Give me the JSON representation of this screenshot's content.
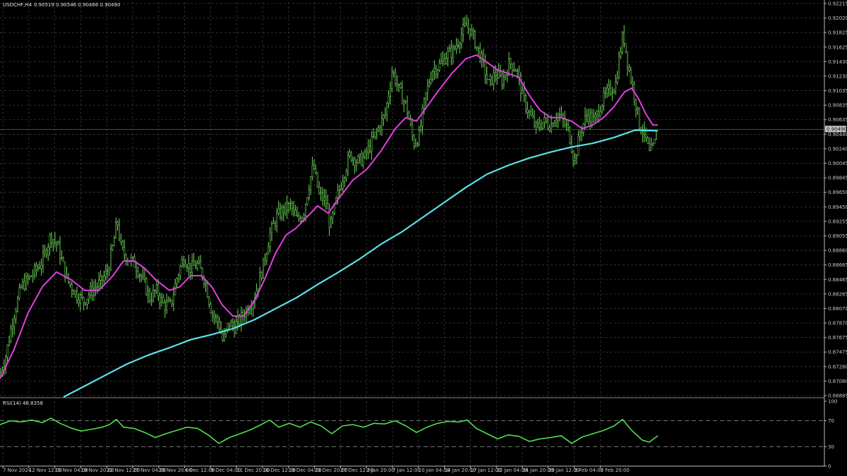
{
  "header": {
    "symbol": "USDCHF,H4",
    "ohlc": "0.90519 0.90546 0.90466 0.90490"
  },
  "rsi_header": "RSI(14) 46.8358",
  "colors": {
    "background": "#000000",
    "grid": "#3a3a3a",
    "axis": "#bdbdbd",
    "candle": "#6fd65a",
    "ma_fast": "#e040e0",
    "ma_slow": "#5fe0e8",
    "rsi": "#4ee04e",
    "price_tag_bg": "#c8c8c8"
  },
  "current_price_label": "0.90490",
  "chart_data": [
    {
      "type": "line",
      "title": "USDCHF,H4",
      "ylim": [
        0.8685,
        0.9222
      ],
      "y_ticks": [
        "0.92215",
        "0.92020",
        "0.91825",
        "0.91625",
        "0.91430",
        "0.91230",
        "0.91035",
        "0.90835",
        "0.90635",
        "0.90440",
        "0.90240",
        "0.90045",
        "0.89845",
        "0.89650",
        "0.89450",
        "0.89255",
        "0.89055",
        "0.88860",
        "0.88665",
        "0.88465",
        "0.88265",
        "0.88070",
        "0.87870",
        "0.87675",
        "0.87475",
        "0.87280",
        "0.87080",
        "0.86885"
      ],
      "x_ticks": [
        "7 Nov 2024",
        "12 Nov 12:00",
        "15 Nov 04:00",
        "19 Nov 20:00",
        "22 Nov 12:00",
        "27 Nov 04:00",
        "29 Nov 20:00",
        "4 Dec 12:00",
        "9 Dec 04:00",
        "11 Dec 20:00",
        "16 Dec 12:00",
        "19 Dec 04:00",
        "23 Dec 20:00",
        "27 Dec 12:00",
        "2 Jan 20:00",
        "7 Jan 12:00",
        "10 Jan 04:00",
        "14 Jan 20:00",
        "17 Jan 12:00",
        "22 Jan 04:00",
        "24 Jan 20:00",
        "29 Jan 12:00",
        "3 Feb 04:00",
        "5 Feb 20:00"
      ],
      "price_path": [
        [
          0,
          0.8715
        ],
        [
          8,
          0.874
        ],
        [
          18,
          0.879
        ],
        [
          30,
          0.8835
        ],
        [
          45,
          0.885
        ],
        [
          60,
          0.887
        ],
        [
          72,
          0.8905
        ],
        [
          82,
          0.889
        ],
        [
          95,
          0.8845
        ],
        [
          108,
          0.8825
        ],
        [
          118,
          0.8815
        ],
        [
          130,
          0.883
        ],
        [
          142,
          0.884
        ],
        [
          152,
          0.8855
        ],
        [
          160,
          0.889
        ],
        [
          166,
          0.8925
        ],
        [
          172,
          0.8885
        ],
        [
          180,
          0.8875
        ],
        [
          192,
          0.8865
        ],
        [
          202,
          0.8845
        ],
        [
          212,
          0.882
        ],
        [
          222,
          0.883
        ],
        [
          232,
          0.881
        ],
        [
          242,
          0.881
        ],
        [
          250,
          0.8845
        ],
        [
          260,
          0.8875
        ],
        [
          270,
          0.886
        ],
        [
          280,
          0.8865
        ],
        [
          290,
          0.8845
        ],
        [
          300,
          0.88
        ],
        [
          310,
          0.8785
        ],
        [
          316,
          0.876
        ],
        [
          324,
          0.8785
        ],
        [
          332,
          0.878
        ],
        [
          340,
          0.879
        ],
        [
          350,
          0.8805
        ],
        [
          360,
          0.882
        ],
        [
          372,
          0.886
        ],
        [
          382,
          0.8905
        ],
        [
          392,
          0.893
        ],
        [
          402,
          0.894
        ],
        [
          412,
          0.8945
        ],
        [
          420,
          0.8925
        ],
        [
          430,
          0.8935
        ],
        [
          438,
          0.8975
        ],
        [
          444,
          0.9
        ],
        [
          452,
          0.896
        ],
        [
          462,
          0.895
        ],
        [
          468,
          0.8915
        ],
        [
          476,
          0.895
        ],
        [
          486,
          0.8985
        ],
        [
          496,
          0.9015
        ],
        [
          506,
          0.9005
        ],
        [
          516,
          0.901
        ],
        [
          526,
          0.903
        ],
        [
          536,
          0.905
        ],
        [
          546,
          0.907
        ],
        [
          556,
          0.913
        ],
        [
          566,
          0.91
        ],
        [
          576,
          0.908
        ],
        [
          586,
          0.903
        ],
        [
          594,
          0.904
        ],
        [
          602,
          0.909
        ],
        [
          612,
          0.913
        ],
        [
          622,
          0.9135
        ],
        [
          632,
          0.915
        ],
        [
          642,
          0.9155
        ],
        [
          652,
          0.9175
        ],
        [
          660,
          0.919
        ],
        [
          666,
          0.9185
        ],
        [
          674,
          0.9165
        ],
        [
          684,
          0.914
        ],
        [
          692,
          0.911
        ],
        [
          702,
          0.9125
        ],
        [
          712,
          0.9115
        ],
        [
          722,
          0.914
        ],
        [
          732,
          0.913
        ],
        [
          740,
          0.9095
        ],
        [
          750,
          0.907
        ],
        [
          760,
          0.905
        ],
        [
          770,
          0.906
        ],
        [
          780,
          0.9055
        ],
        [
          790,
          0.907
        ],
        [
          798,
          0.906
        ],
        [
          806,
          0.9045
        ],
        [
          814,
          0.9005
        ],
        [
          822,
          0.9045
        ],
        [
          832,
          0.907
        ],
        [
          842,
          0.906
        ],
        [
          852,
          0.9085
        ],
        [
          862,
          0.91
        ],
        [
          872,
          0.911
        ],
        [
          878,
          0.915
        ],
        [
          883,
          0.918
        ],
        [
          890,
          0.9135
        ],
        [
          898,
          0.91
        ],
        [
          906,
          0.9055
        ],
        [
          914,
          0.904
        ],
        [
          920,
          0.9015
        ],
        [
          926,
          0.9025
        ],
        [
          932,
          0.9049
        ]
      ],
      "series": [
        {
          "name": "",
          "color": "#e040e0",
          "values": [
            [
              0,
              0.871
            ],
            [
              20,
              0.875
            ],
            [
              40,
              0.88
            ],
            [
              60,
              0.8835
            ],
            [
              80,
              0.8855
            ],
            [
              100,
              0.8845
            ],
            [
              120,
              0.883
            ],
            [
              140,
              0.883
            ],
            [
              160,
              0.885
            ],
            [
              175,
              0.887
            ],
            [
              190,
              0.887
            ],
            [
              205,
              0.886
            ],
            [
              220,
              0.8845
            ],
            [
              240,
              0.883
            ],
            [
              255,
              0.8835
            ],
            [
              270,
              0.885
            ],
            [
              285,
              0.885
            ],
            [
              300,
              0.8835
            ],
            [
              315,
              0.881
            ],
            [
              330,
              0.8795
            ],
            [
              345,
              0.8795
            ],
            [
              360,
              0.8815
            ],
            [
              375,
              0.8845
            ],
            [
              390,
              0.888
            ],
            [
              405,
              0.8905
            ],
            [
              420,
              0.8915
            ],
            [
              435,
              0.893
            ],
            [
              450,
              0.8945
            ],
            [
              465,
              0.8935
            ],
            [
              480,
              0.8955
            ],
            [
              500,
              0.898
            ],
            [
              520,
              0.8995
            ],
            [
              540,
              0.902
            ],
            [
              560,
              0.905
            ],
            [
              575,
              0.9065
            ],
            [
              590,
              0.906
            ],
            [
              605,
              0.908
            ],
            [
              620,
              0.91
            ],
            [
              640,
              0.9125
            ],
            [
              660,
              0.9145
            ],
            [
              675,
              0.915
            ],
            [
              690,
              0.914
            ],
            [
              705,
              0.913
            ],
            [
              720,
              0.9125
            ],
            [
              735,
              0.912
            ],
            [
              750,
              0.9095
            ],
            [
              765,
              0.9075
            ],
            [
              780,
              0.9065
            ],
            [
              795,
              0.9065
            ],
            [
              810,
              0.906
            ],
            [
              825,
              0.905
            ],
            [
              840,
              0.9055
            ],
            [
              855,
              0.9065
            ],
            [
              870,
              0.908
            ],
            [
              885,
              0.91
            ],
            [
              895,
              0.9105
            ],
            [
              905,
              0.909
            ],
            [
              915,
              0.907
            ],
            [
              925,
              0.9055
            ],
            [
              932,
              0.9055
            ]
          ]
        },
        {
          "name": "",
          "color": "#5fe0e8",
          "values": [
            [
              90,
              0.8685
            ],
            [
              120,
              0.87
            ],
            [
              150,
              0.8715
            ],
            [
              180,
              0.873
            ],
            [
              210,
              0.8742
            ],
            [
              240,
              0.8752
            ],
            [
              270,
              0.8763
            ],
            [
              300,
              0.877
            ],
            [
              330,
              0.8778
            ],
            [
              360,
              0.879
            ],
            [
              390,
              0.8805
            ],
            [
              420,
              0.882
            ],
            [
              450,
              0.8838
            ],
            [
              480,
              0.8855
            ],
            [
              510,
              0.8873
            ],
            [
              540,
              0.8893
            ],
            [
              570,
              0.891
            ],
            [
              600,
              0.893
            ],
            [
              630,
              0.895
            ],
            [
              660,
              0.897
            ],
            [
              690,
              0.8988
            ],
            [
              720,
              0.9
            ],
            [
              750,
              0.901
            ],
            [
              780,
              0.9018
            ],
            [
              810,
              0.9025
            ],
            [
              840,
              0.903
            ],
            [
              870,
              0.9038
            ],
            [
              900,
              0.9048
            ],
            [
              932,
              0.9047
            ]
          ]
        }
      ]
    },
    {
      "type": "line",
      "title": "RSI(14) 46.8358",
      "ylim": [
        0,
        100
      ],
      "y_ticks": [
        "100",
        "70",
        "30",
        "0"
      ],
      "levels": [
        70,
        30
      ],
      "series": [
        {
          "name": "",
          "color": "#4ee04e",
          "values": [
            [
              0,
              64
            ],
            [
              15,
              70
            ],
            [
              30,
              68
            ],
            [
              45,
              71
            ],
            [
              60,
              67
            ],
            [
              72,
              74
            ],
            [
              85,
              66
            ],
            [
              100,
              59
            ],
            [
              115,
              54
            ],
            [
              130,
              57
            ],
            [
              145,
              60
            ],
            [
              155,
              64
            ],
            [
              165,
              72
            ],
            [
              175,
              60
            ],
            [
              190,
              58
            ],
            [
              205,
              52
            ],
            [
              220,
              44
            ],
            [
              235,
              50
            ],
            [
              250,
              55
            ],
            [
              265,
              60
            ],
            [
              280,
              58
            ],
            [
              295,
              48
            ],
            [
              310,
              35
            ],
            [
              325,
              44
            ],
            [
              340,
              50
            ],
            [
              355,
              56
            ],
            [
              370,
              64
            ],
            [
              382,
              71
            ],
            [
              395,
              60
            ],
            [
              410,
              66
            ],
            [
              425,
              60
            ],
            [
              440,
              68
            ],
            [
              455,
              62
            ],
            [
              470,
              50
            ],
            [
              485,
              62
            ],
            [
              500,
              64
            ],
            [
              515,
              60
            ],
            [
              530,
              66
            ],
            [
              545,
              65
            ],
            [
              560,
              70
            ],
            [
              575,
              62
            ],
            [
              590,
              52
            ],
            [
              605,
              60
            ],
            [
              620,
              66
            ],
            [
              635,
              69
            ],
            [
              650,
              68
            ],
            [
              662,
              71
            ],
            [
              675,
              58
            ],
            [
              690,
              50
            ],
            [
              705,
              42
            ],
            [
              720,
              48
            ],
            [
              735,
              46
            ],
            [
              750,
              38
            ],
            [
              765,
              42
            ],
            [
              780,
              44
            ],
            [
              795,
              47
            ],
            [
              810,
              35
            ],
            [
              825,
              45
            ],
            [
              840,
              50
            ],
            [
              855,
              55
            ],
            [
              870,
              62
            ],
            [
              882,
              72
            ],
            [
              895,
              55
            ],
            [
              910,
              40
            ],
            [
              920,
              37
            ],
            [
              932,
              47
            ]
          ]
        }
      ]
    }
  ]
}
